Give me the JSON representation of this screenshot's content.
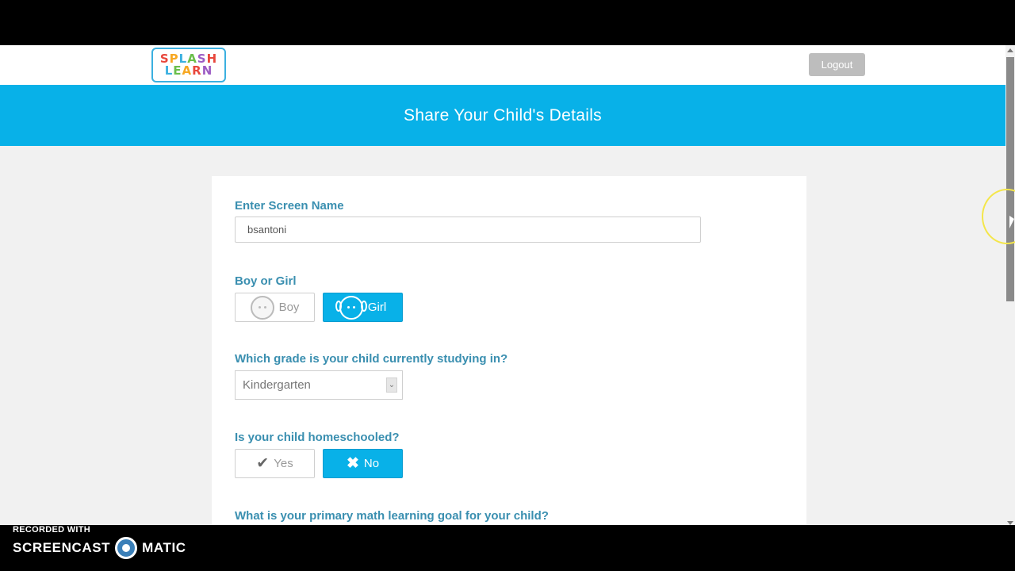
{
  "header": {
    "logo_line1": "SPLASH",
    "logo_line2": "LEARN",
    "logout_label": "Logout"
  },
  "banner": {
    "title": "Share Your Child's Details"
  },
  "form": {
    "screen_name": {
      "label": "Enter Screen Name",
      "value": "bsantoni"
    },
    "gender": {
      "label": "Boy or Girl",
      "options": [
        {
          "label": "Boy",
          "icon": "boy-face-icon",
          "selected": false
        },
        {
          "label": "Girl",
          "icon": "girl-face-icon",
          "selected": true
        }
      ]
    },
    "grade": {
      "label": "Which grade is your child currently studying in?",
      "selected": "Kindergarten"
    },
    "homeschooled": {
      "label": "Is your child homeschooled?",
      "options": [
        {
          "label": "Yes",
          "icon": "checkmark-icon",
          "selected": false
        },
        {
          "label": "No",
          "icon": "x-icon",
          "selected": true
        }
      ]
    },
    "goal": {
      "label": "What is your primary math learning goal for your child?"
    }
  },
  "watermark": {
    "small": "RECORDED WITH",
    "left": "SCREENCAST",
    "right": "MATIC"
  },
  "colors": {
    "brand_blue": "#08b1e8",
    "label_blue": "#3a8fb0",
    "logout_gray": "#bdbdbd"
  }
}
